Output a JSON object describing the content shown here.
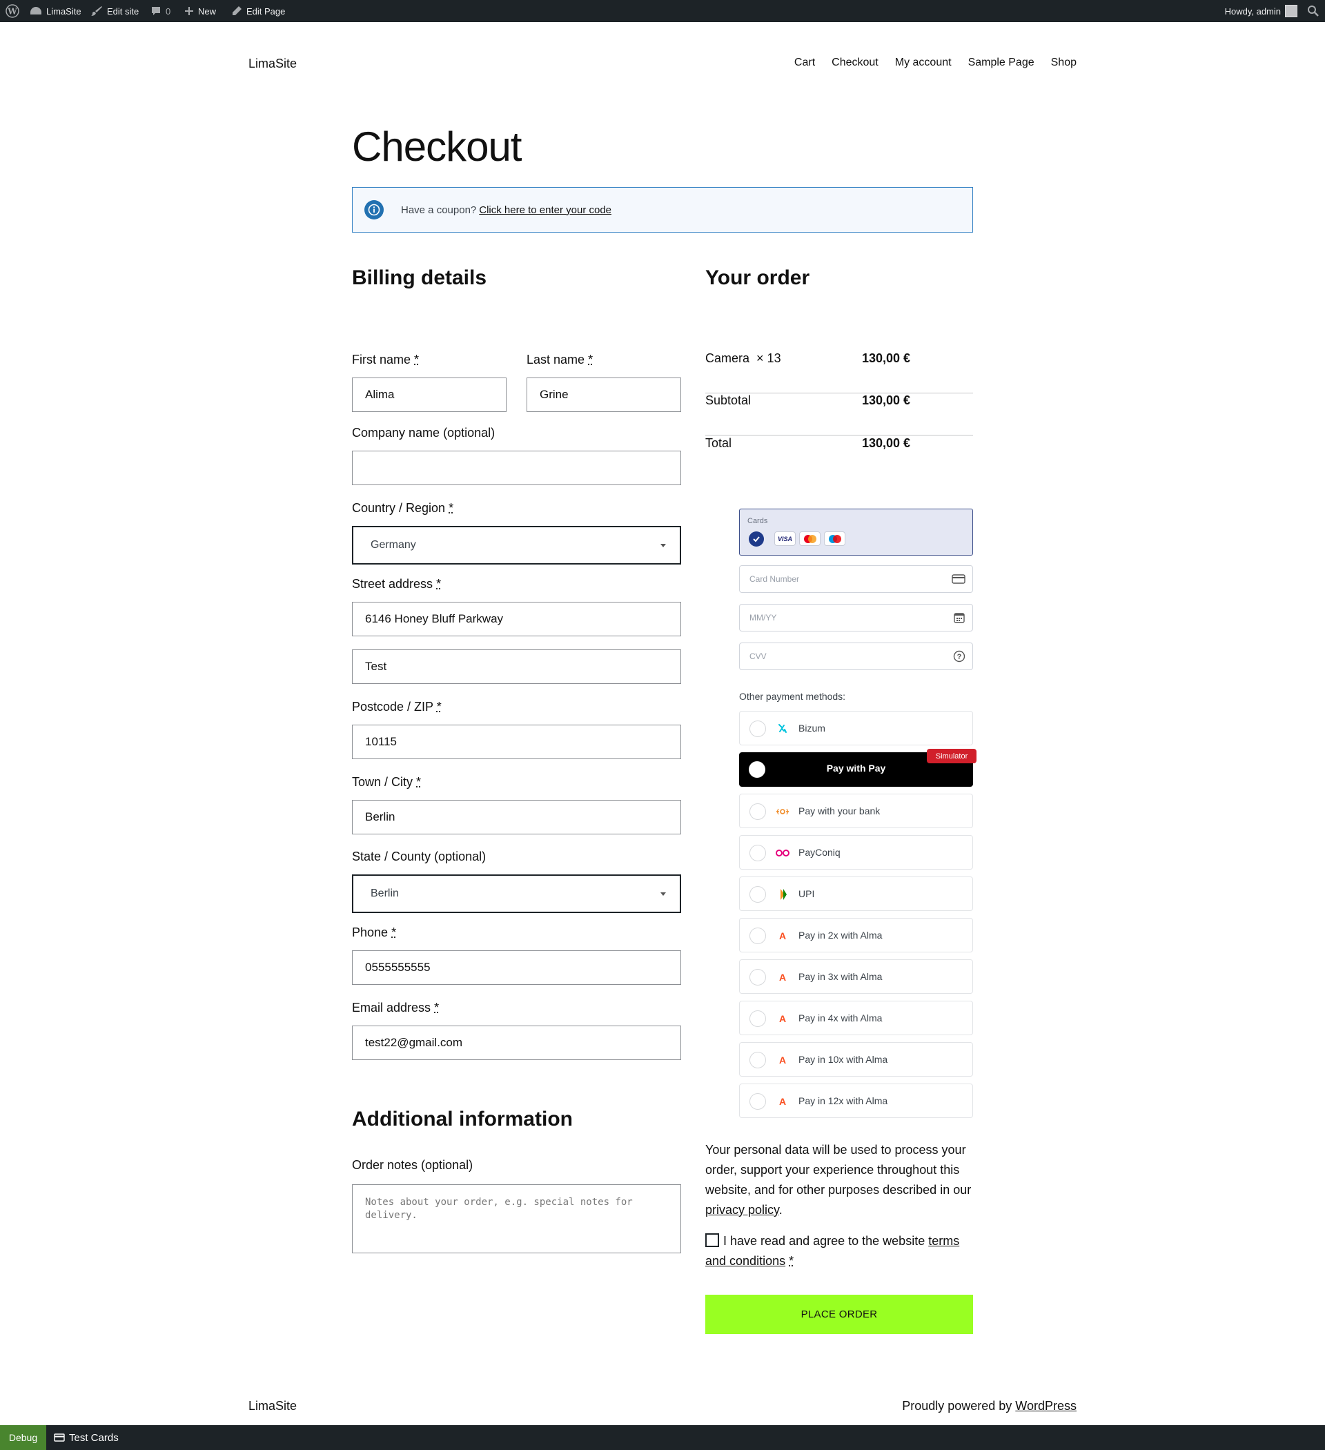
{
  "adminbar": {
    "site": "LimaSite",
    "edit_site": "Edit site",
    "comments_count": "0",
    "new": "New",
    "edit_page": "Edit Page",
    "howdy": "Howdy, admin"
  },
  "header": {
    "site_title": "LimaSite",
    "nav": [
      "Cart",
      "Checkout",
      "My account",
      "Sample Page",
      "Shop"
    ]
  },
  "page": {
    "title": "Checkout",
    "coupon_prompt": "Have a coupon?",
    "coupon_link": "Click here to enter your code"
  },
  "billing": {
    "heading": "Billing details",
    "first_name_label": "First name",
    "first_name": "Alima",
    "last_name_label": "Last name",
    "last_name": "Grine",
    "company_label": "Company name (optional)",
    "company": "",
    "country_label": "Country / Region",
    "country": "Germany",
    "street_label": "Street address",
    "street1": "6146 Honey Bluff Parkway",
    "street2": "Test",
    "postcode_label": "Postcode / ZIP",
    "postcode": "10115",
    "city_label": "Town / City",
    "city": "Berlin",
    "state_label": "State / County (optional)",
    "state": "Berlin",
    "phone_label": "Phone",
    "phone": "0555555555",
    "email_label": "Email address",
    "email": "test22@gmail.com",
    "required_mark": "*"
  },
  "additional": {
    "heading": "Additional information",
    "notes_label": "Order notes (optional)",
    "notes_placeholder": "Notes about your order, e.g. special notes for delivery."
  },
  "order": {
    "heading": "Your order",
    "item_name": "Camera",
    "item_qty": "× 13",
    "item_total": "130,00 €",
    "subtotal_label": "Subtotal",
    "subtotal": "130,00 €",
    "total_label": "Total",
    "total": "130,00 €"
  },
  "payment": {
    "cards_caption": "Cards",
    "card_brands": [
      "VISA",
      "mastercard",
      "maestro"
    ],
    "card_number_placeholder": "Card Number",
    "expiry_placeholder": "MM/YY",
    "cvv_placeholder": "CVV",
    "other_label": "Other payment methods:",
    "methods": [
      {
        "label": "Bizum",
        "icon": "bizum-icon"
      },
      {
        "label": "Pay with your bank",
        "icon": "bank-icon"
      },
      {
        "label": "PayConiq",
        "icon": "payconiq-icon"
      },
      {
        "label": "UPI",
        "icon": "upi-icon"
      },
      {
        "label": "Pay in 2x with Alma",
        "icon": "alma-icon"
      },
      {
        "label": "Pay in 3x with Alma",
        "icon": "alma-icon"
      },
      {
        "label": "Pay in 4x with Alma",
        "icon": "alma-icon"
      },
      {
        "label": "Pay in 10x with Alma",
        "icon": "alma-icon"
      },
      {
        "label": "Pay in 12x with Alma",
        "icon": "alma-icon"
      }
    ],
    "apple_pay_label": "Pay with  Pay",
    "simulator_badge": "Simulator"
  },
  "privacy": {
    "text": "Your personal data will be used to process your order, support your experience throughout this website, and for other purposes described in our",
    "link": "privacy policy",
    "end": "."
  },
  "terms": {
    "text": "I have read and agree to the website",
    "link": "terms and conditions",
    "required": "*"
  },
  "place_order": "PLACE ORDER",
  "footer": {
    "site_title": "LimaSite",
    "powered": "Proudly powered by",
    "powered_link": "WordPress"
  },
  "debugbar": {
    "debug": "Debug",
    "test_cards": "Test Cards"
  },
  "colors": {
    "accent_green": "#99ff22",
    "admin_bar": "#1d2327",
    "info_blue": "#2271b1",
    "sim_red": "#d11f2a"
  }
}
